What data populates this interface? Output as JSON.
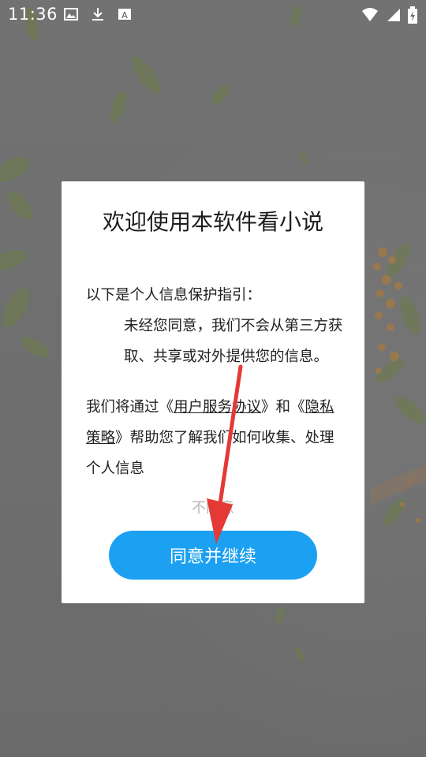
{
  "status_bar": {
    "time": "11:36",
    "left_icons": [
      "image-icon",
      "download-icon",
      "font-a-icon"
    ],
    "right_icons": [
      "wifi-icon",
      "signal-icon",
      "battery-charging-icon"
    ]
  },
  "dialog": {
    "title": "欢迎使用本软件看小说",
    "intro": "以下是个人信息保护指引：",
    "line1": "未经您同意，我们不会从第三方获取、共享或对外提供您的信息。",
    "para2_prefix": "我们将通过《",
    "user_agreement_link": "用户服务协议",
    "para2_middle": "》和《",
    "privacy_link": "隐私策略",
    "para2_suffix": "》帮助您了解我们如何收集、处理个人信息",
    "disagree_label": "不同意",
    "agree_label": "同意并继续"
  },
  "colors": {
    "accent": "#1BA0F2",
    "annotation_arrow": "#E53935",
    "overlay": "#6E6E6E"
  }
}
